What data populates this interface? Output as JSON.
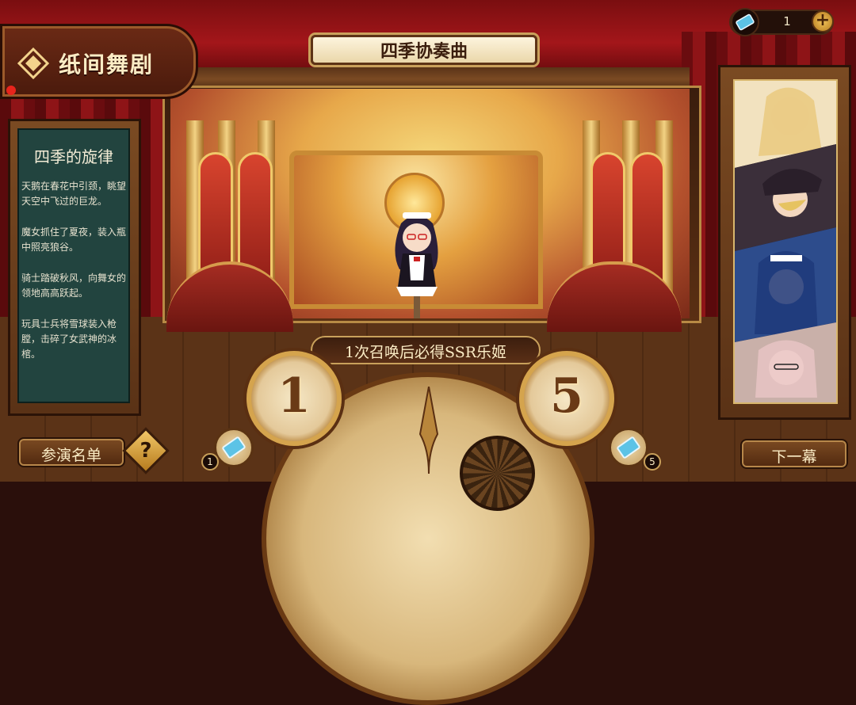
{
  "header": {
    "game_title": "纸间舞剧",
    "banner_title": "四季协奏曲"
  },
  "currency": {
    "ticket_count": "1",
    "add_label": "+"
  },
  "story": {
    "title": "四季的旋律",
    "paragraphs": [
      "天鹅在春花中引颈，眺望天空中飞过的巨龙。",
      "魔女抓住了夏夜，装入瓶中照亮狼谷。",
      "骑士踏破秋风，向舞女的领地高高跃起。",
      "玩具士兵将雪球装入枪膛，击碎了女武神的冰棺。"
    ]
  },
  "summon": {
    "guarantee_text": "1次召唤后必得SSR乐姬",
    "single": {
      "label": "1",
      "cost": "1"
    },
    "multi": {
      "label": "5",
      "cost": "5"
    }
  },
  "footer": {
    "cast_list_label": "参演名单",
    "help_label": "?",
    "next_label": "下一幕"
  },
  "colors": {
    "curtain_red": "#a3161a",
    "wood_brown": "#5a3216",
    "gold_trim": "#c9a15b",
    "chalkboard": "#22443f",
    "cream_text": "#fbecc5"
  }
}
